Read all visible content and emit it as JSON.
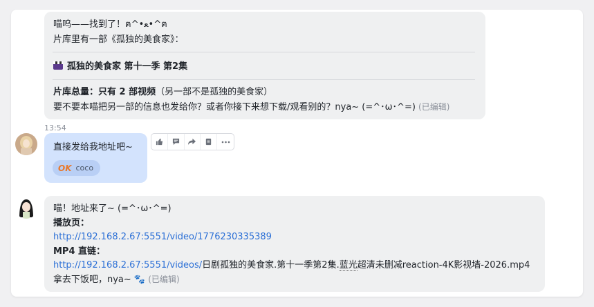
{
  "messages": {
    "bot1": {
      "line1": "喵呜——找到了！ฅ^•ﻌ•^ฅ",
      "line2": "片库里有一部《孤独的美食家》：",
      "movie_title": "孤独的美食家 第十一季 第2集",
      "total_label": "片库总量：只有 2 部视频",
      "total_note": "（另一部不是孤独的美食家）",
      "line5": "要不要本喵把另一部的信息也发给你？或者你接下来想下载/观看别的？nya~ (=^･ω･^=)",
      "edited": "(已编辑)"
    },
    "user": {
      "time": "13:54",
      "text": "直接发给我地址吧~",
      "reaction_badge": "OK",
      "reaction_user": "coco"
    },
    "bot2": {
      "line1": "喵！地址来了~ (=^･ω･^=)",
      "play_label": "播放页：",
      "play_url": "http://192.168.2.67:5551/video/1776230335389",
      "mp4_label": "MP4 直链：",
      "mp4_url_link": "http://192.168.2.67:5551/videos/",
      "mp4_url_tail1": "日剧孤独的美食家.第十一季第2集.",
      "mp4_url_dotted": "蓝光",
      "mp4_url_tail2": "超清未删减reaction-4K影视墙-2026.mp4",
      "closing": "拿去下饭吧，nya~ 🐾",
      "edited": "(已编辑)"
    }
  },
  "toolbar": {
    "like_icon": "thumbs-up-icon",
    "comment_icon": "comment-icon",
    "forward_icon": "forward-icon",
    "quote_icon": "quote-icon",
    "more_icon": "more-icon"
  },
  "colors": {
    "bubble_gray": "#eff0f1",
    "bubble_blue": "#d3e3fd",
    "link": "#2b6fd6"
  }
}
